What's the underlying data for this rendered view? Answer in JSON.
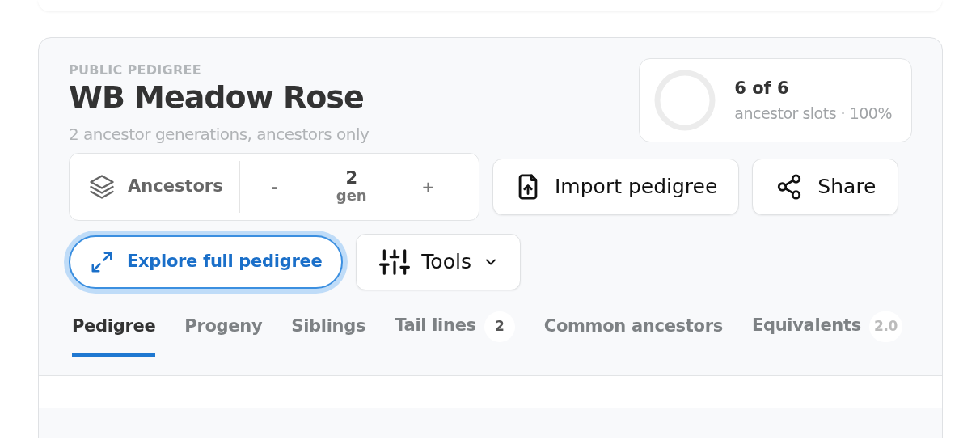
{
  "header": {
    "eyebrow": "PUBLIC PEDIGREE",
    "title": "WB Meadow Rose",
    "subtitle": "2 ancestor generations, ancestors only"
  },
  "coverage": {
    "count": "6 of 6",
    "caption": "ancestor slots · 100%"
  },
  "mode": {
    "label": "Ancestors",
    "decrement": "-",
    "value": "2",
    "unit": "gen",
    "increment": "+"
  },
  "buttons": [
    {
      "kind": "import",
      "label": "Import pedigree"
    },
    {
      "kind": "share",
      "label": "Share"
    }
  ],
  "explore": {
    "label": "Explore full pedigree",
    "focused": true
  },
  "tools": {
    "label": "Tools"
  },
  "tabs": [
    {
      "label": "Pedigree",
      "selected": true
    },
    {
      "label": "Progeny",
      "selected": false
    },
    {
      "label": "Siblings",
      "selected": false
    },
    {
      "label": "Tail lines",
      "selected": false,
      "badge": "2"
    },
    {
      "label": "Common ancestors",
      "selected": false
    },
    {
      "label": "Equivalents",
      "selected": false,
      "badge": "2.0"
    }
  ]
}
